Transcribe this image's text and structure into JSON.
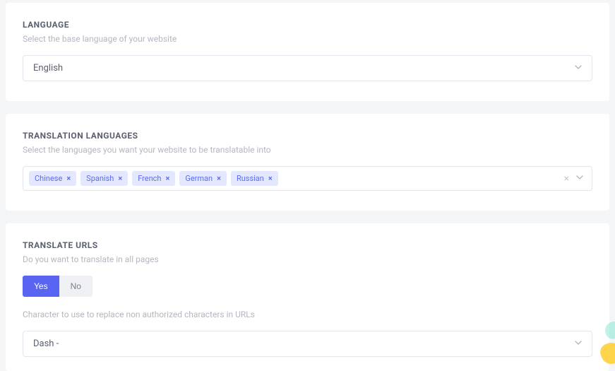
{
  "language": {
    "title": "LANGUAGE",
    "desc": "Select the base language of your website",
    "selected": "English"
  },
  "translation": {
    "title": "TRANSLATION LANGUAGES",
    "desc": "Select the languages you want your website to be translatable into",
    "tags": [
      "Chinese",
      "Spanish",
      "French",
      "German",
      "Russian"
    ]
  },
  "urls": {
    "title": "TRANSLATE URLS",
    "desc1": "Do you want to translate in all pages",
    "toggle": {
      "yes": "Yes",
      "no": "No",
      "active": "yes"
    },
    "desc2": "Character to use to replace non authorized characters in URLs",
    "selected": "Dash -"
  },
  "icons": {
    "remove": "×",
    "clear": "×"
  }
}
